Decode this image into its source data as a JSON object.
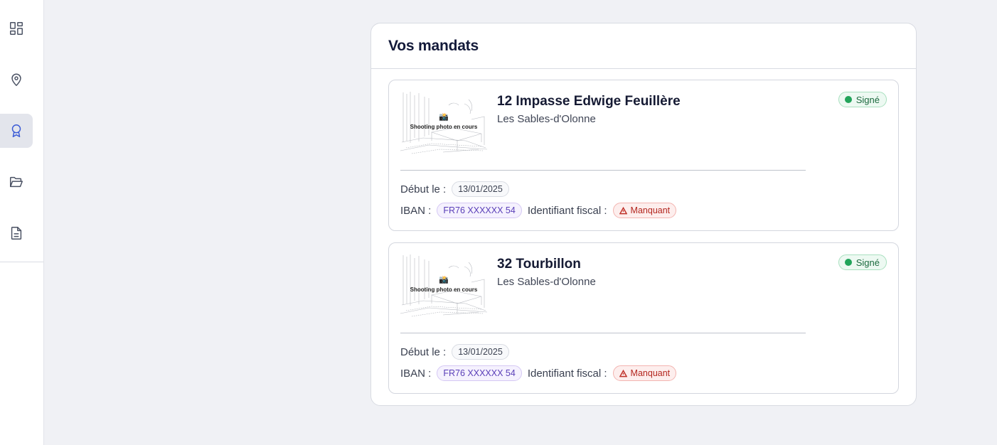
{
  "sidebar": {
    "items": [
      {
        "icon": "dashboard-grid-icon"
      },
      {
        "icon": "map-pin-icon"
      },
      {
        "icon": "award-badge-icon",
        "active": true
      },
      {
        "icon": "folder-open-icon"
      },
      {
        "icon": "document-icon"
      }
    ]
  },
  "panel": {
    "title": "Vos mandats"
  },
  "mandates": [
    {
      "photo_camera": "📸",
      "photo_label": "Shooting photo en cours",
      "address": "12 Impasse Edwige Feuillère",
      "city": "Les Sables-d'Olonne",
      "status": "Signé",
      "start_label": "Début le :",
      "start_date": "13/01/2025",
      "iban_label": "IBAN :",
      "iban": "FR76 XXXXXX 54",
      "fiscal_label": "Identifiant fiscal :",
      "fiscal_status": "Manquant"
    },
    {
      "photo_camera": "📸",
      "photo_label": "Shooting photo en cours",
      "address": "32 Tourbillon",
      "city": "Les Sables-d'Olonne",
      "status": "Signé",
      "start_label": "Début le :",
      "start_date": "13/01/2025",
      "iban_label": "IBAN :",
      "iban": "FR76 XXXXXX 54",
      "fiscal_label": "Identifiant fiscal :",
      "fiscal_status": "Manquant"
    }
  ],
  "colors": {
    "accent": "#3b5bd6",
    "signed_green": "#22a45a",
    "missing_red": "#c0332b",
    "iban_purple": "#5a3fb8"
  }
}
